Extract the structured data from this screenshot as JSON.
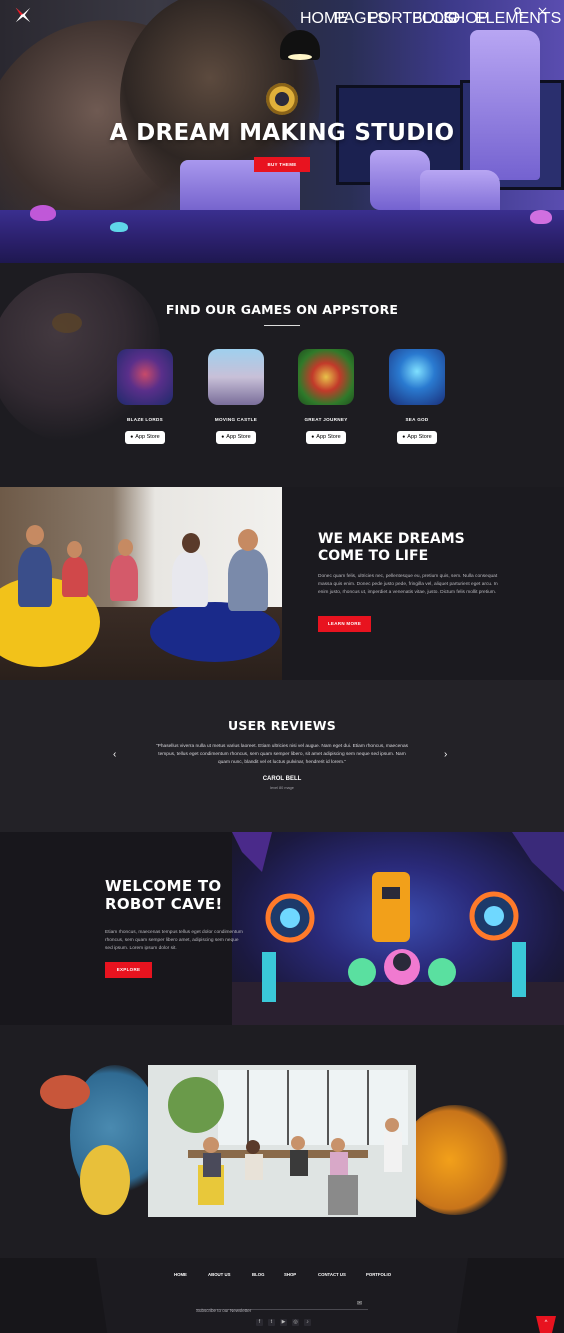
{
  "nav": {
    "items": [
      "HOME",
      "PAGES",
      "PORTFOLIO",
      "BLOG",
      "SHOP",
      "ELEMENTS"
    ],
    "active": "HOME",
    "icons": [
      "search-icon",
      "close-icon"
    ]
  },
  "hero": {
    "title": "A DREAM MAKING STUDIO",
    "button": "BUY THEME"
  },
  "appstore": {
    "title": "FIND OUR GAMES ON APPSTORE",
    "games": [
      {
        "name": "BLAZE LORDS",
        "badge": "App Store"
      },
      {
        "name": "MOVING CASTLE",
        "badge": "App Store"
      },
      {
        "name": "GREAT JOURNEY",
        "badge": "App Store"
      },
      {
        "name": "SEA GOD",
        "badge": "App Store"
      }
    ]
  },
  "dreams": {
    "title_line1": "WE MAKE DREAMS",
    "title_line2": "COME TO LIFE",
    "text": "Donec quam felis, ultricies nec, pellentesque eu, pretium quis, sem. Nulla consequat massa quis enim. Donec pede justo pede, fringilla vel, aliquet parturient eget arcu. In enim justo, rhoncus ut, imperdiet a venenatis vitae, justo. Dictum felis mollit pretium.",
    "button": "LEARN MORE"
  },
  "reviews": {
    "title": "USER REVIEWS",
    "quote": "\"Phasellus viverra nulla ut metus varius laoreet. Etiam ultricies nisi vel augue. Nam eget dui. Etiam rhoncus, maecenas tempus, tellus eget condimentum rhoncus, sem quam semper libero, sit amet adipiscing sem neque sed ipsum. Nam quam nunc, blandit vel et luctus pulvinar, hendrerit id lorem.\"",
    "name": "CAROL BELL",
    "role": "level 80 mage",
    "prev": "‹",
    "next": "›"
  },
  "robot": {
    "title_line1": "WELCOME TO",
    "title_line2": "ROBOT CAVE!",
    "text": "Etiam rhoncus, maecenas tempus tellus eget dolor condimentum rhoncus, sem quam semper libero amet, adipiscing sem neque sed ipsum. Lorem ipsum dolor sit.",
    "button": "EXPLORE"
  },
  "footer": {
    "nav": [
      "HOME",
      "ABOUT US",
      "BLOG",
      "SHOP",
      "CONTACT US",
      "PORTFOLIO"
    ],
    "newsletter_placeholder": "Subscribe to our Newsletter",
    "send": "✉",
    "social": [
      "f",
      "t",
      "▶",
      "◎",
      "♪"
    ],
    "to_top": "^"
  },
  "colors": {
    "accent": "#e8131f",
    "background": "#1c1b20"
  }
}
